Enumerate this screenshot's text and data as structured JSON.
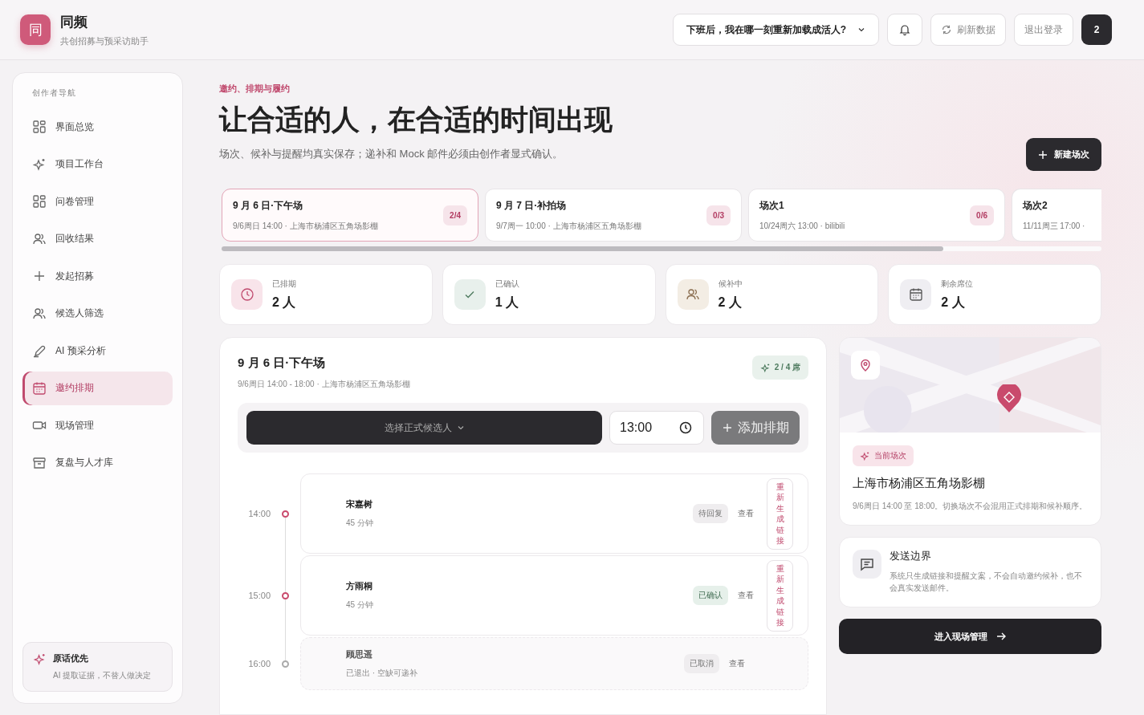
{
  "app": {
    "logo": "同",
    "name": "同频",
    "tagline": "共创招募与预采访助手"
  },
  "header": {
    "question": "下班后，我在哪一刻重新加载成活人?",
    "refresh": "刷新数据",
    "logout": "退出登录",
    "count": "2"
  },
  "sidebar": {
    "heading": "创作者导航",
    "items": [
      {
        "label": "界面总览",
        "selected": false
      },
      {
        "label": "项目工作台",
        "selected": false
      },
      {
        "label": "问卷管理",
        "selected": false
      },
      {
        "label": "回收结果",
        "selected": false
      },
      {
        "label": "发起招募",
        "selected": false
      },
      {
        "label": "候选人筛选",
        "selected": false
      },
      {
        "label": "AI 预采分析",
        "selected": false
      },
      {
        "label": "邀约排期",
        "selected": true
      },
      {
        "label": "现场管理",
        "selected": false
      },
      {
        "label": "复盘与人才库",
        "selected": false
      }
    ],
    "note": {
      "title": "原话优先",
      "text": "AI 提取证据，不替人做决定"
    }
  },
  "page": {
    "kicker": "邀约、排期与履约",
    "title": "让合适的人，在合适的时间出现",
    "subtitle": "场次、候补与提醒均真实保存；递补和 Mock 邮件必须由创作者显式确认。",
    "new_button": "新建场次"
  },
  "sessions": [
    {
      "title": "9 月 6 日·下午场",
      "detail": "9/6周日 14:00 · 上海市杨浦区五角场影棚",
      "count": "2/4",
      "selected": true
    },
    {
      "title": "9 月 7 日·补拍场",
      "detail": "9/7周一 10:00 · 上海市杨浦区五角场影棚",
      "count": "0/3",
      "selected": false
    },
    {
      "title": "场次1",
      "detail": "10/24周六 13:00 · bilibili",
      "count": "0/6",
      "selected": false
    },
    {
      "title": "场次2",
      "detail": "11/11周三 17:00 ·",
      "selected": false
    }
  ],
  "stats": [
    {
      "kind": "scheduled",
      "label": "已排期",
      "value": "2 人"
    },
    {
      "kind": "confirmed",
      "label": "已确认",
      "value": "1 人"
    },
    {
      "kind": "waitlist",
      "label": "候补中",
      "value": "2 人"
    },
    {
      "kind": "remaining",
      "label": "剩余席位",
      "value": "2 人"
    }
  ],
  "schedule": {
    "title": "9 月 6 日·下午场",
    "detail": "9/6周日 14:00 - 18:00 · 上海市杨浦区五角场影棚",
    "seats": "2 / 4 席",
    "candidate_select": "选择正式候选人",
    "time": "13:00",
    "add_button": "添加排期",
    "rows": [
      {
        "time": "14:00",
        "name": "宋嘉树",
        "meta": "45 分钟",
        "status": "待回复",
        "kind": "pending",
        "view": "查看",
        "regenerate": "重新生成链接"
      },
      {
        "time": "15:00",
        "name": "方雨桐",
        "meta": "45 分钟",
        "status": "已确认",
        "kind": "confirmed",
        "view": "查看",
        "regenerate": "重新生成链接"
      },
      {
        "time": "16:00",
        "name": "顾思遥",
        "meta": "已退出 · 空缺可递补",
        "status": "已取消",
        "kind": "cancelled",
        "view": "查看"
      }
    ]
  },
  "venue": {
    "tag": "当前场次",
    "name": "上海市杨浦区五角场影棚",
    "detail": "9/6周日 14:00 至 18:00。切换场次不会混用正式排期和候补顺序。"
  },
  "boundary": {
    "title": "发送边界",
    "text": "系统只生成链接和提醒文案，不会自动邀约候补，也不会真实发送邮件。"
  },
  "enter_button": "进入现场管理"
}
